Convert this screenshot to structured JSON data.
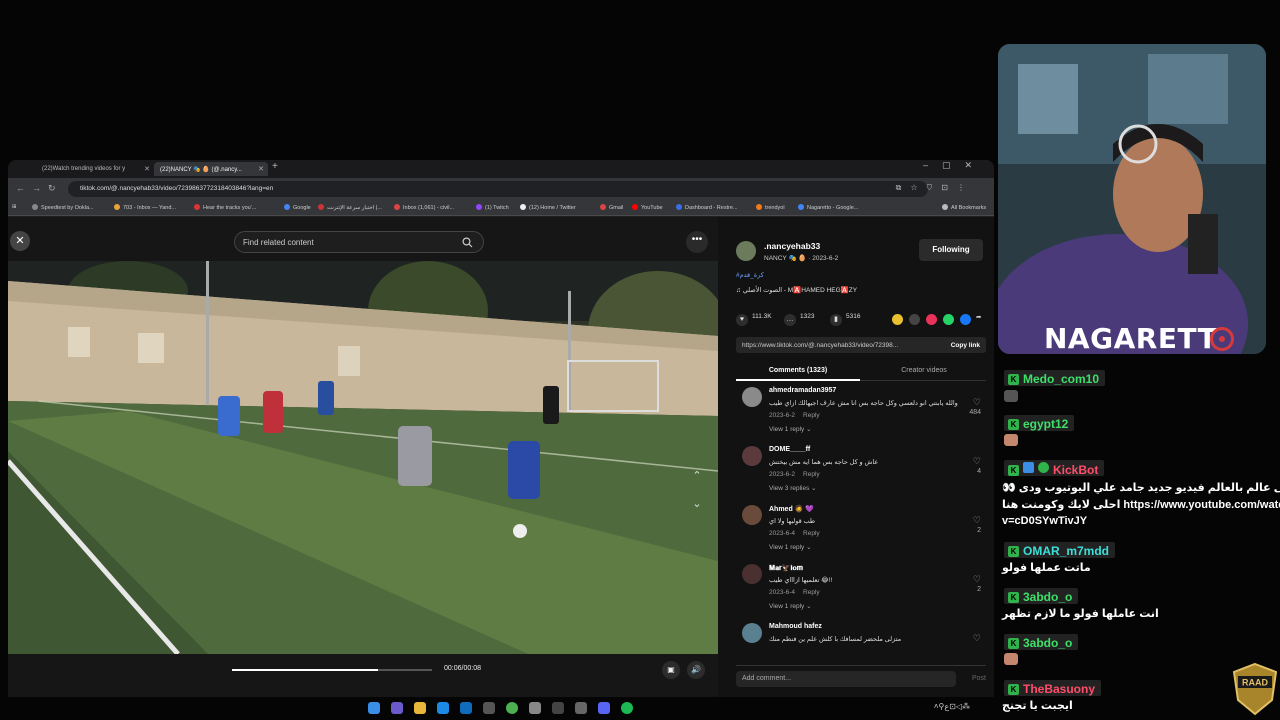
{
  "browser": {
    "tabs": [
      {
        "label": "(22)Watch trending videos for y",
        "active": false
      },
      {
        "label": "(22)NANCY 🎭 🥚 (@.nancy...",
        "active": true
      }
    ],
    "new_tab": "+",
    "url": "tiktok.com/@.nancyehab33/video/7239863772318403846?lang=en",
    "bookmarks": [
      {
        "label": "Speedtest by Ookla...",
        "color": "#888"
      },
      {
        "label": "703 - Inbox — Yand...",
        "color": "#e8a43a"
      },
      {
        "label": "Hear the tracks you'...",
        "color": "#d33"
      },
      {
        "label": "Google",
        "color": "#4285f4"
      },
      {
        "label": "اختبار سرعة الإنترنت |...",
        "color": "#c33"
      },
      {
        "label": "Inbox (1,061) - civil...",
        "color": "#d44"
      },
      {
        "label": "(1) Twitch",
        "color": "#9146ff"
      },
      {
        "label": "(12) Home / Twitter",
        "color": "#eee"
      },
      {
        "label": "Gmail",
        "color": "#d44"
      },
      {
        "label": "YouTube",
        "color": "#f00"
      },
      {
        "label": "Dashboard - Restre...",
        "color": "#3a6ee8"
      },
      {
        "label": "trendyol",
        "color": "#f27a1a"
      },
      {
        "label": "Nagaretto - Google...",
        "color": "#4285f4"
      },
      {
        "label": "All Bookmarks",
        "color": "#bbb"
      }
    ]
  },
  "tiktok": {
    "search_placeholder": "Find related content",
    "time": "00:06/00:08",
    "progress": 0.73,
    "author": {
      "handle": ".nancyehab33",
      "sub": "NANCY 🎭 🥚 · 2023-6-2",
      "follow_label": "Following"
    },
    "hashtag": "#كرة_قدم",
    "music": "♫  الصوت الأصلي - M🅰️HAMED HEG🅰️ZY",
    "stats": {
      "likes": "111.3K",
      "comments": "1323",
      "saves": "5316"
    },
    "link": "https://www.tiktok.com/@.nancyehab33/video/72398...",
    "copy_label": "Copy link",
    "tab_comments": "Comments (1323)",
    "tab_creator": "Creator videos",
    "comments": [
      {
        "user": "ahmedramadan3957",
        "text": "والله يابنتي انو دلعسي وكل حاجه بس انا مش عارف اجيهالك ازاي طيب",
        "date": "2023-6-2",
        "reply": "Reply",
        "view": "View 1 reply ⌄",
        "likes": "484",
        "avatar": "#8a8a8a"
      },
      {
        "user": "DOME____ff",
        "text": "عاش و كل حاجه بس هما ايه مش بيختش",
        "date": "2023-6-2",
        "reply": "Reply",
        "view": "View 3 replies ⌄",
        "likes": "4",
        "avatar": "#5a3a3a"
      },
      {
        "user": "Ahmed 🧔 💜",
        "text": "طب قوليها ولا اي",
        "date": "2023-6-4",
        "reply": "Reply",
        "view": "View 1 reply ⌄",
        "likes": "2",
        "avatar": "#6a4a3a"
      },
      {
        "user": "𝐌𝐚𝐫🦅𝐢𝐨𝐦",
        "text": "تعلميها ازاااي طيب 😂!!",
        "date": "2023-6-4",
        "reply": "Reply",
        "view": "View 1 reply ⌄",
        "likes": "2",
        "avatar": "#4a3030"
      },
      {
        "user": "Mahmoud hafez",
        "text": "متزلى ملحضر لمسافك با كلش علم ين فنطم منك",
        "date": "",
        "reply": "",
        "view": "",
        "likes": "",
        "avatar": "#5a7f90"
      }
    ],
    "add_comment_placeholder": "Add comment...",
    "post_label": "Post"
  },
  "overlay": {
    "streamer_name": "NAGARETT",
    "chat": [
      {
        "user": "Medo_com10",
        "message": ""
      },
      {
        "user": "egypt12",
        "message": ""
      },
      {
        "user": "KickBot",
        "message_line1": "👀 اخواتى احلى عالم بالعالم فيديو جديد جامد علي اليوتيوب ودى",
        "message_line2": "احلى لايك وكومنت هنا https://www.youtube.com/watch?",
        "message_line3": "v=cD0SYwTivJY"
      },
      {
        "user": "OMAR_m7mdd",
        "message": "ماتت عملها فولو"
      },
      {
        "user": "3abdo_o",
        "message": "انت عاملها فولو ما لازم تظهر"
      },
      {
        "user": "3abdo_o",
        "message": ""
      },
      {
        "user": "TheBasuony",
        "message": "ايجبت يا تجنج"
      }
    ],
    "raad_label": "RAAD"
  },
  "colors": {
    "accent_green": "#3ee06a",
    "kickbot_red": "#ff4d6a",
    "tiktok_bg": "#121212"
  }
}
